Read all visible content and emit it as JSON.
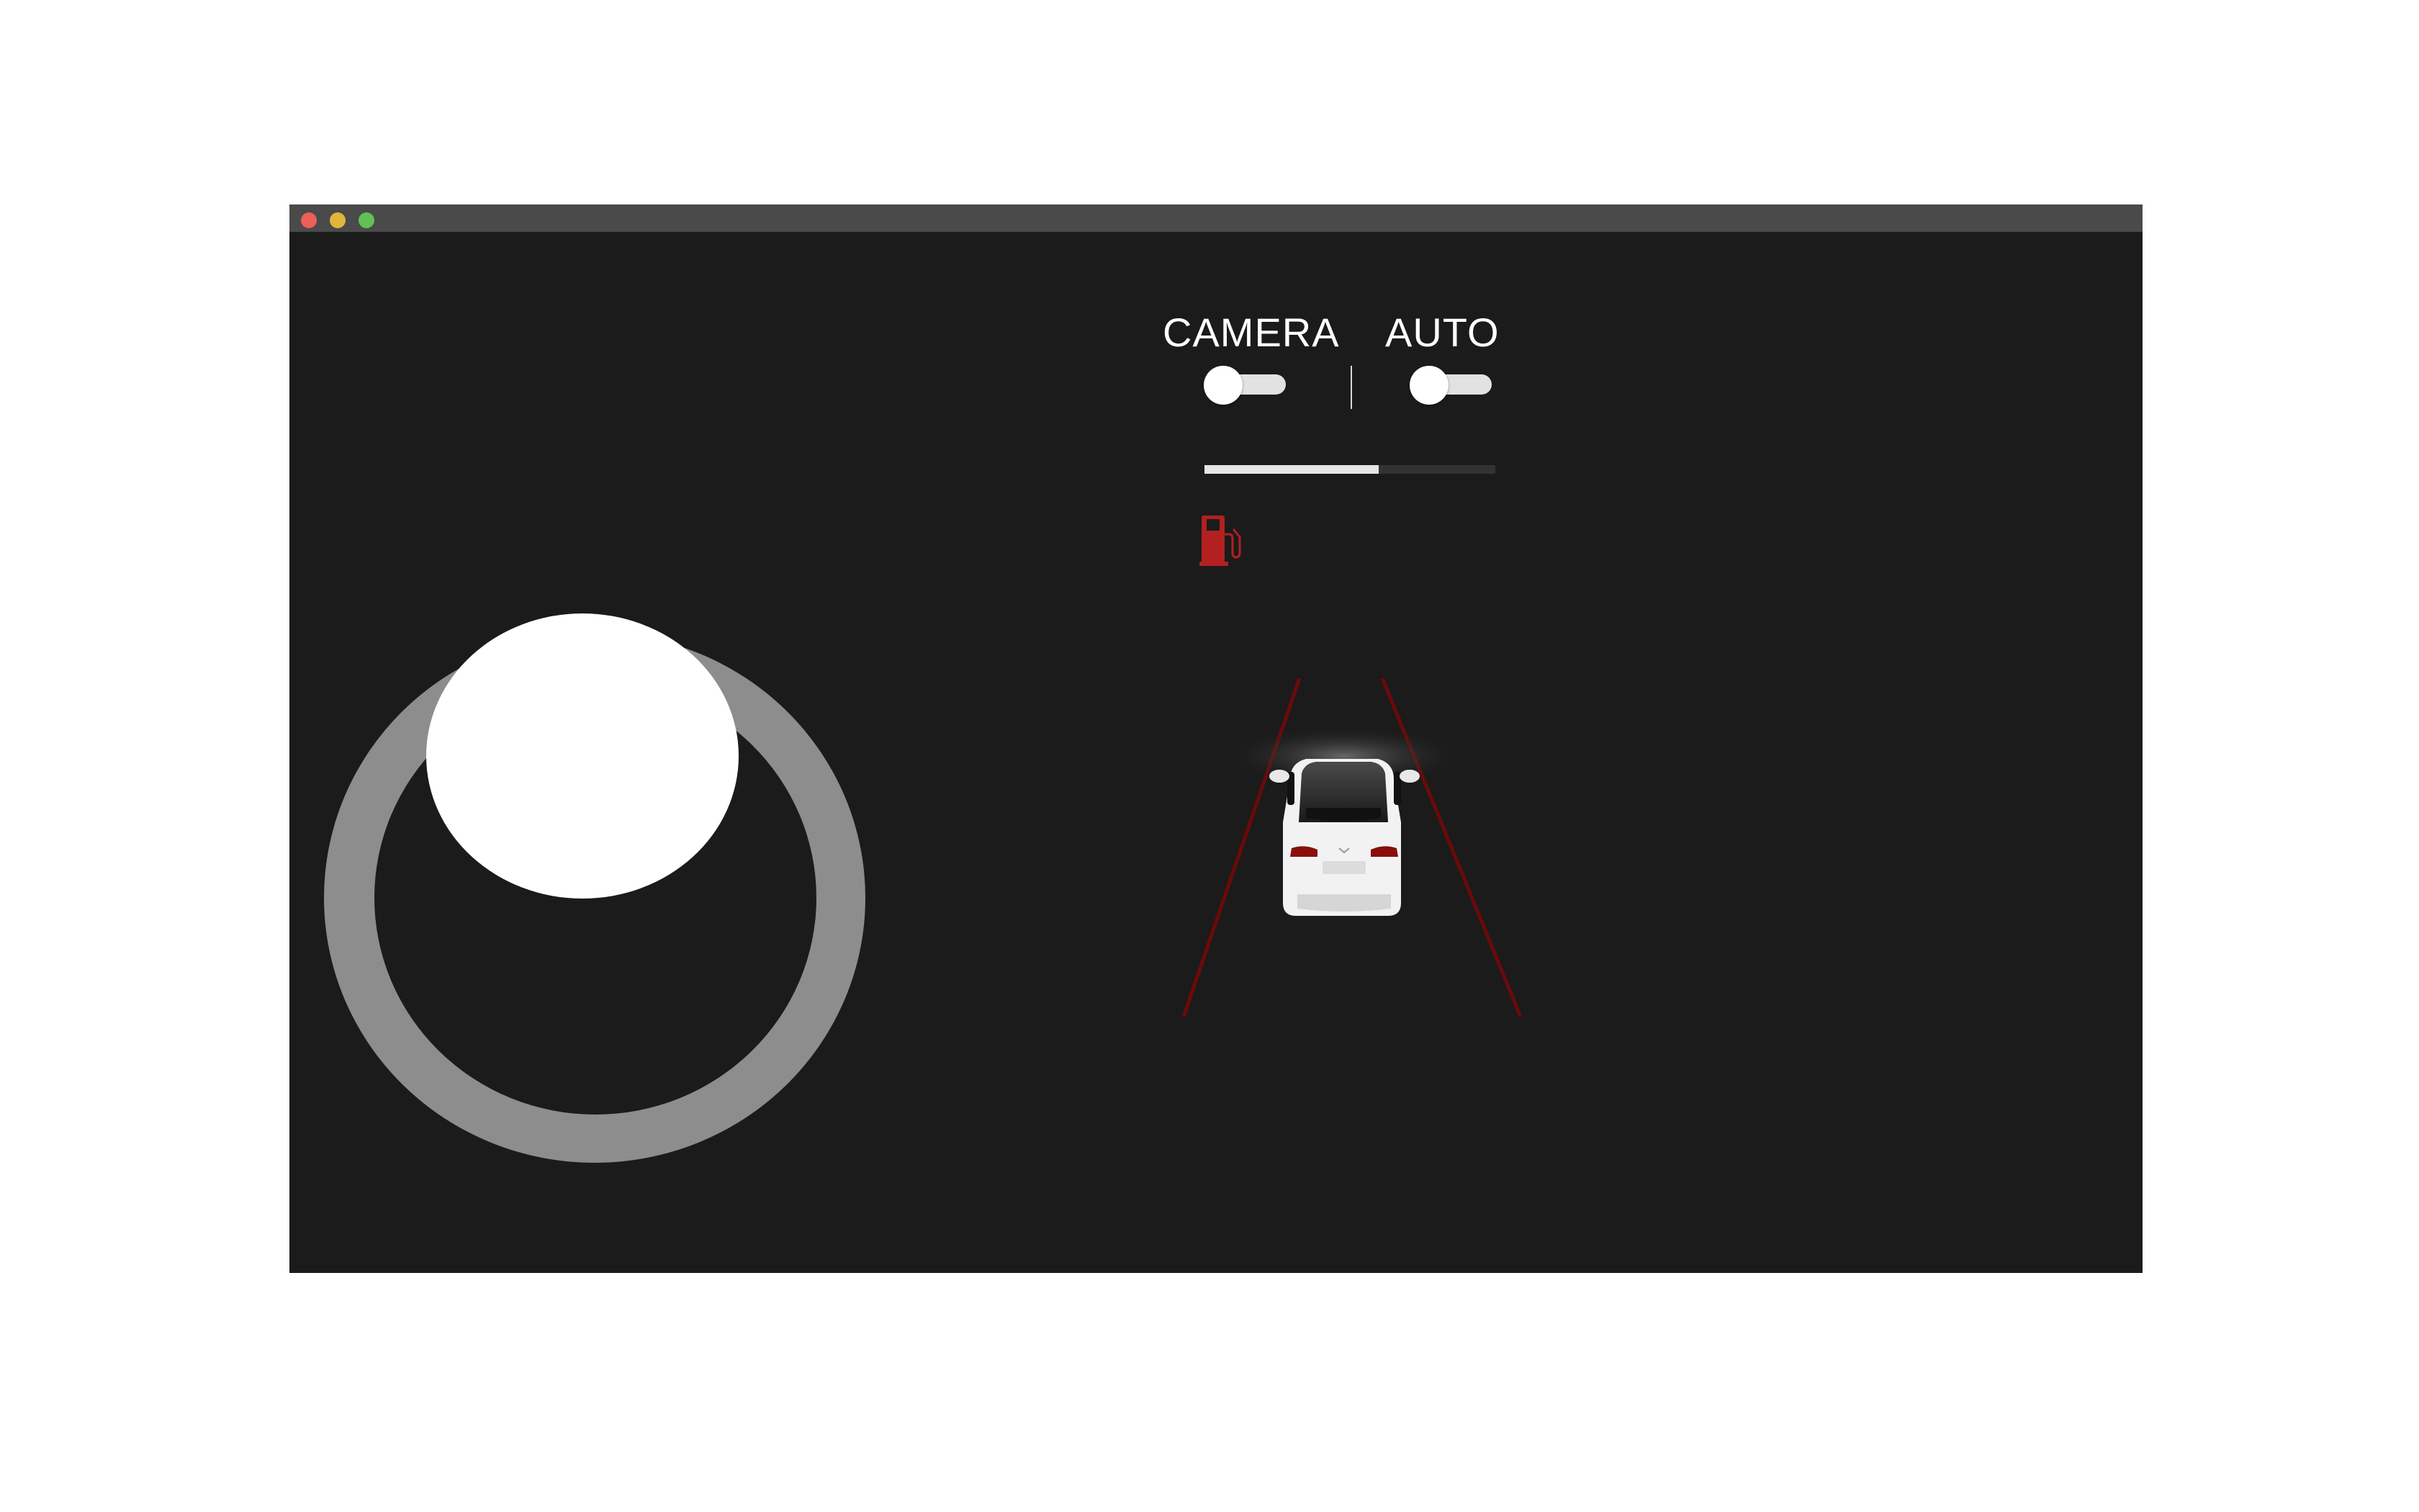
{
  "window": {
    "buttons": [
      "close",
      "minimize",
      "maximize"
    ]
  },
  "controls": {
    "camera_label": "CAMERA",
    "auto_label": "AUTO",
    "camera_on": false,
    "auto_on": false
  },
  "status": {
    "progress_fraction": 0.6,
    "fuel_icon": "fuel-pump-icon",
    "fuel_color": "#b32020"
  },
  "joystick": {
    "ring_color": "#8d8d8d",
    "knob_color": "#ffffff"
  },
  "vehicle": {
    "icon": "car-rear-view-icon",
    "lane_line_color": "#6b0a0a"
  }
}
